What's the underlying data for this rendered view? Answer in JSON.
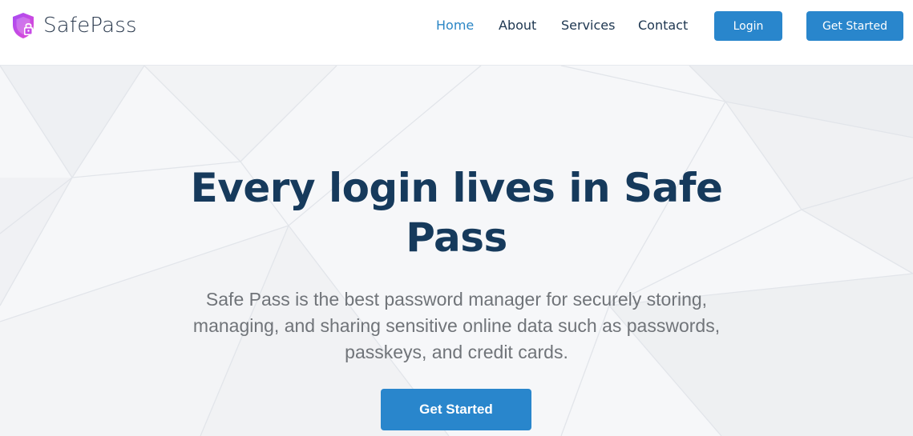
{
  "brand": {
    "name": "SafePass",
    "icon": "shield-lock-icon",
    "icon_colors": [
      "#a64bf4",
      "#e44ad3"
    ]
  },
  "nav": {
    "links": [
      {
        "label": "Home",
        "active": true
      },
      {
        "label": "About",
        "active": false
      },
      {
        "label": "Services",
        "active": false
      },
      {
        "label": "Contact",
        "active": false
      }
    ],
    "login_label": "Login",
    "get_started_label": "Get Started"
  },
  "hero": {
    "title": "Every login lives in Safe Pass",
    "description": "Safe Pass is the best password manager for securely storing, managing, and sharing sensitive online data such as passwords, passkeys, and credit cards.",
    "cta_label": "Get Started"
  },
  "colors": {
    "accent": "#2986cc",
    "active_link": "#2b86c5",
    "heading": "#163a5c",
    "body_text": "#707479",
    "hero_background": "#f6f7f9"
  }
}
